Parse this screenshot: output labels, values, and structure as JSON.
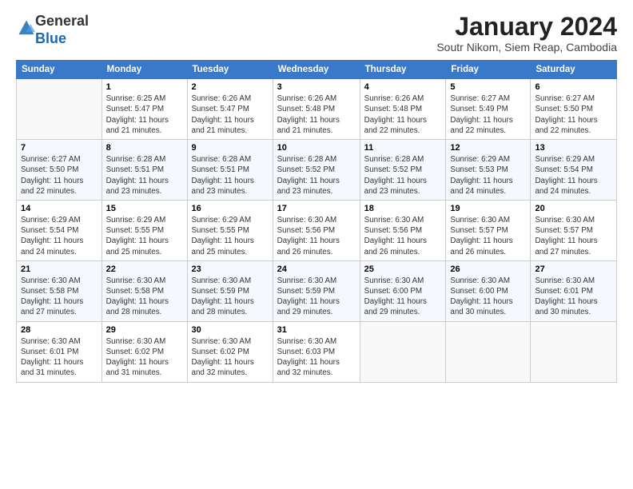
{
  "logo": {
    "general": "General",
    "blue": "Blue"
  },
  "header": {
    "title": "January 2024",
    "location": "Soutr Nikom, Siem Reap, Cambodia"
  },
  "days_of_week": [
    "Sunday",
    "Monday",
    "Tuesday",
    "Wednesday",
    "Thursday",
    "Friday",
    "Saturday"
  ],
  "weeks": [
    [
      {
        "day": "",
        "info": ""
      },
      {
        "day": "1",
        "info": "Sunrise: 6:25 AM\nSunset: 5:47 PM\nDaylight: 11 hours\nand 21 minutes."
      },
      {
        "day": "2",
        "info": "Sunrise: 6:26 AM\nSunset: 5:47 PM\nDaylight: 11 hours\nand 21 minutes."
      },
      {
        "day": "3",
        "info": "Sunrise: 6:26 AM\nSunset: 5:48 PM\nDaylight: 11 hours\nand 21 minutes."
      },
      {
        "day": "4",
        "info": "Sunrise: 6:26 AM\nSunset: 5:48 PM\nDaylight: 11 hours\nand 22 minutes."
      },
      {
        "day": "5",
        "info": "Sunrise: 6:27 AM\nSunset: 5:49 PM\nDaylight: 11 hours\nand 22 minutes."
      },
      {
        "day": "6",
        "info": "Sunrise: 6:27 AM\nSunset: 5:50 PM\nDaylight: 11 hours\nand 22 minutes."
      }
    ],
    [
      {
        "day": "7",
        "info": "Sunrise: 6:27 AM\nSunset: 5:50 PM\nDaylight: 11 hours\nand 22 minutes."
      },
      {
        "day": "8",
        "info": "Sunrise: 6:28 AM\nSunset: 5:51 PM\nDaylight: 11 hours\nand 23 minutes."
      },
      {
        "day": "9",
        "info": "Sunrise: 6:28 AM\nSunset: 5:51 PM\nDaylight: 11 hours\nand 23 minutes."
      },
      {
        "day": "10",
        "info": "Sunrise: 6:28 AM\nSunset: 5:52 PM\nDaylight: 11 hours\nand 23 minutes."
      },
      {
        "day": "11",
        "info": "Sunrise: 6:28 AM\nSunset: 5:52 PM\nDaylight: 11 hours\nand 23 minutes."
      },
      {
        "day": "12",
        "info": "Sunrise: 6:29 AM\nSunset: 5:53 PM\nDaylight: 11 hours\nand 24 minutes."
      },
      {
        "day": "13",
        "info": "Sunrise: 6:29 AM\nSunset: 5:54 PM\nDaylight: 11 hours\nand 24 minutes."
      }
    ],
    [
      {
        "day": "14",
        "info": "Sunrise: 6:29 AM\nSunset: 5:54 PM\nDaylight: 11 hours\nand 24 minutes."
      },
      {
        "day": "15",
        "info": "Sunrise: 6:29 AM\nSunset: 5:55 PM\nDaylight: 11 hours\nand 25 minutes."
      },
      {
        "day": "16",
        "info": "Sunrise: 6:29 AM\nSunset: 5:55 PM\nDaylight: 11 hours\nand 25 minutes."
      },
      {
        "day": "17",
        "info": "Sunrise: 6:30 AM\nSunset: 5:56 PM\nDaylight: 11 hours\nand 26 minutes."
      },
      {
        "day": "18",
        "info": "Sunrise: 6:30 AM\nSunset: 5:56 PM\nDaylight: 11 hours\nand 26 minutes."
      },
      {
        "day": "19",
        "info": "Sunrise: 6:30 AM\nSunset: 5:57 PM\nDaylight: 11 hours\nand 26 minutes."
      },
      {
        "day": "20",
        "info": "Sunrise: 6:30 AM\nSunset: 5:57 PM\nDaylight: 11 hours\nand 27 minutes."
      }
    ],
    [
      {
        "day": "21",
        "info": "Sunrise: 6:30 AM\nSunset: 5:58 PM\nDaylight: 11 hours\nand 27 minutes."
      },
      {
        "day": "22",
        "info": "Sunrise: 6:30 AM\nSunset: 5:58 PM\nDaylight: 11 hours\nand 28 minutes."
      },
      {
        "day": "23",
        "info": "Sunrise: 6:30 AM\nSunset: 5:59 PM\nDaylight: 11 hours\nand 28 minutes."
      },
      {
        "day": "24",
        "info": "Sunrise: 6:30 AM\nSunset: 5:59 PM\nDaylight: 11 hours\nand 29 minutes."
      },
      {
        "day": "25",
        "info": "Sunrise: 6:30 AM\nSunset: 6:00 PM\nDaylight: 11 hours\nand 29 minutes."
      },
      {
        "day": "26",
        "info": "Sunrise: 6:30 AM\nSunset: 6:00 PM\nDaylight: 11 hours\nand 30 minutes."
      },
      {
        "day": "27",
        "info": "Sunrise: 6:30 AM\nSunset: 6:01 PM\nDaylight: 11 hours\nand 30 minutes."
      }
    ],
    [
      {
        "day": "28",
        "info": "Sunrise: 6:30 AM\nSunset: 6:01 PM\nDaylight: 11 hours\nand 31 minutes."
      },
      {
        "day": "29",
        "info": "Sunrise: 6:30 AM\nSunset: 6:02 PM\nDaylight: 11 hours\nand 31 minutes."
      },
      {
        "day": "30",
        "info": "Sunrise: 6:30 AM\nSunset: 6:02 PM\nDaylight: 11 hours\nand 32 minutes."
      },
      {
        "day": "31",
        "info": "Sunrise: 6:30 AM\nSunset: 6:03 PM\nDaylight: 11 hours\nand 32 minutes."
      },
      {
        "day": "",
        "info": ""
      },
      {
        "day": "",
        "info": ""
      },
      {
        "day": "",
        "info": ""
      }
    ]
  ]
}
